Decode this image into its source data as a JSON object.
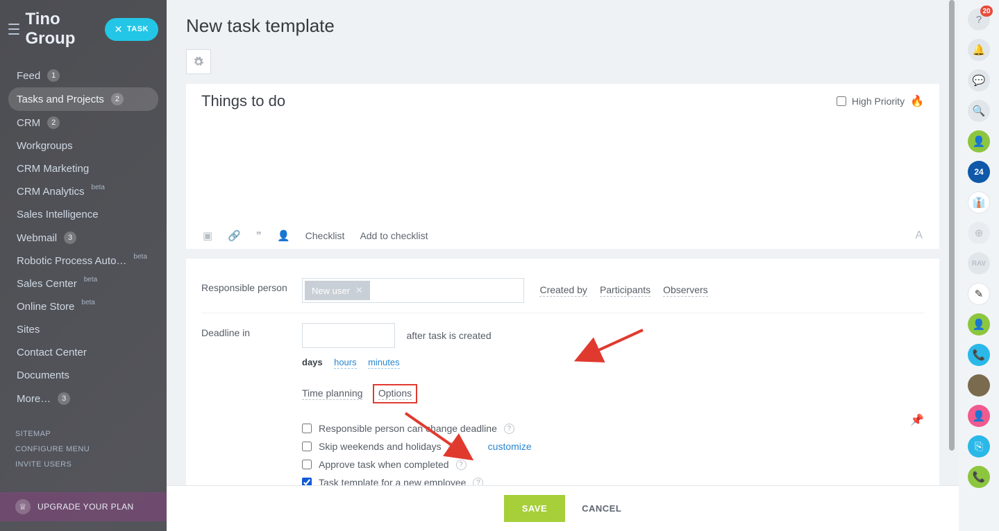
{
  "header": {
    "logo": "Tino Group",
    "task_btn": "TASK"
  },
  "sidebar": {
    "items": [
      {
        "label": "Feed",
        "badge": "1"
      },
      {
        "label": "Tasks and Projects",
        "badge": "2",
        "active": true
      },
      {
        "label": "CRM",
        "badge": "2"
      },
      {
        "label": "Workgroups"
      },
      {
        "label": "CRM Marketing"
      },
      {
        "label": "CRM Analytics",
        "beta": "beta"
      },
      {
        "label": "Sales Intelligence"
      },
      {
        "label": "Webmail",
        "badge": "3"
      },
      {
        "label": "Robotic Process Auto…",
        "beta": "beta"
      },
      {
        "label": "Sales Center",
        "beta": "beta"
      },
      {
        "label": "Online Store",
        "beta": "beta"
      },
      {
        "label": "Sites"
      },
      {
        "label": "Contact Center"
      },
      {
        "label": "Documents"
      },
      {
        "label": "More… ",
        "badge": "3"
      }
    ],
    "footer": {
      "sitemap": "SITEMAP",
      "config": "CONFIGURE MENU",
      "invite": "INVITE USERS"
    },
    "upgrade": "UPGRADE YOUR PLAN"
  },
  "page": {
    "title": "New task template",
    "things_to_do": "Things to do",
    "high_priority": "High Priority",
    "toolbar": {
      "checklist": "Checklist",
      "add": "Add to checklist"
    },
    "responsible": {
      "label": "Responsible person",
      "chip": "New user"
    },
    "role_links": {
      "created": "Created by",
      "participants": "Participants",
      "observers": "Observers"
    },
    "deadline": {
      "label": "Deadline in",
      "after": "after task is created",
      "units": {
        "days": "days",
        "hours": "hours",
        "minutes": "minutes"
      },
      "time_planning": "Time planning",
      "options": "Options"
    },
    "options": {
      "o1": "Responsible person can change deadline",
      "o2": "Skip weekends and holidays",
      "o3": "Approve task when completed",
      "o4": "Task template for a new employee",
      "customize": "customize"
    },
    "buttons": {
      "save": "SAVE",
      "cancel": "CANCEL"
    }
  },
  "rail": {
    "notif_count": "20",
    "b24": "24",
    "rav": "RAV"
  }
}
